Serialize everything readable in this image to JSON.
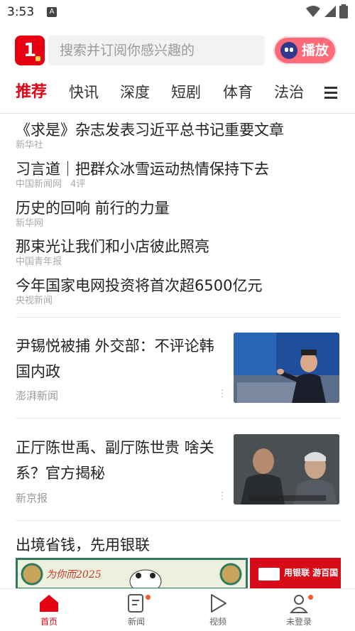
{
  "status_bar": {
    "time": "3:53",
    "notif_icon": "A"
  },
  "header": {
    "logo_text": "1",
    "search_placeholder": "搜索并订阅你感兴趣的",
    "play_button_label": "播放"
  },
  "tabs": [
    {
      "label": "推荐",
      "active": true
    },
    {
      "label": "快讯"
    },
    {
      "label": "深度"
    },
    {
      "label": "短剧"
    },
    {
      "label": "体育"
    },
    {
      "label": "法治"
    }
  ],
  "headlines": [
    {
      "title": "《求是》杂志发表习近平总书记重要文章",
      "source": "新华社",
      "comments": ""
    },
    {
      "title": "习言道｜把群众冰雪运动热情保持下去",
      "source": "中国新闻网",
      "comments": "4评"
    },
    {
      "title": "历史的回响 前行的力量",
      "source": "新华网",
      "comments": ""
    },
    {
      "title": "那束光让我们和小店彼此照亮",
      "source": "中国青年报",
      "comments": ""
    },
    {
      "title": "今年国家电网投资将首次超6500亿元",
      "source": "央视新闻",
      "comments": ""
    }
  ],
  "news_items": [
    {
      "title": "尹锡悦被捕 外交部：不评论韩国内政",
      "source": "澎湃新闻"
    },
    {
      "title": "正厅陈世禹、副厅陈世贵 啥关系？官方揭秘",
      "source": "新京报"
    }
  ],
  "ad": {
    "title": "出境省钱，先用银联",
    "banner_left_text": "为你而2025",
    "banner_right_text": "用银联 游百国"
  },
  "bottom_nav": [
    {
      "label": "首页",
      "icon": "home-icon",
      "active": true
    },
    {
      "label": "新闻",
      "icon": "news-icon",
      "badge": true
    },
    {
      "label": "视频",
      "icon": "play-icon"
    },
    {
      "label": "未登录",
      "icon": "user-icon",
      "badge": true
    }
  ],
  "colors": {
    "accent": "#e60012",
    "badge": "#f25a2b"
  }
}
